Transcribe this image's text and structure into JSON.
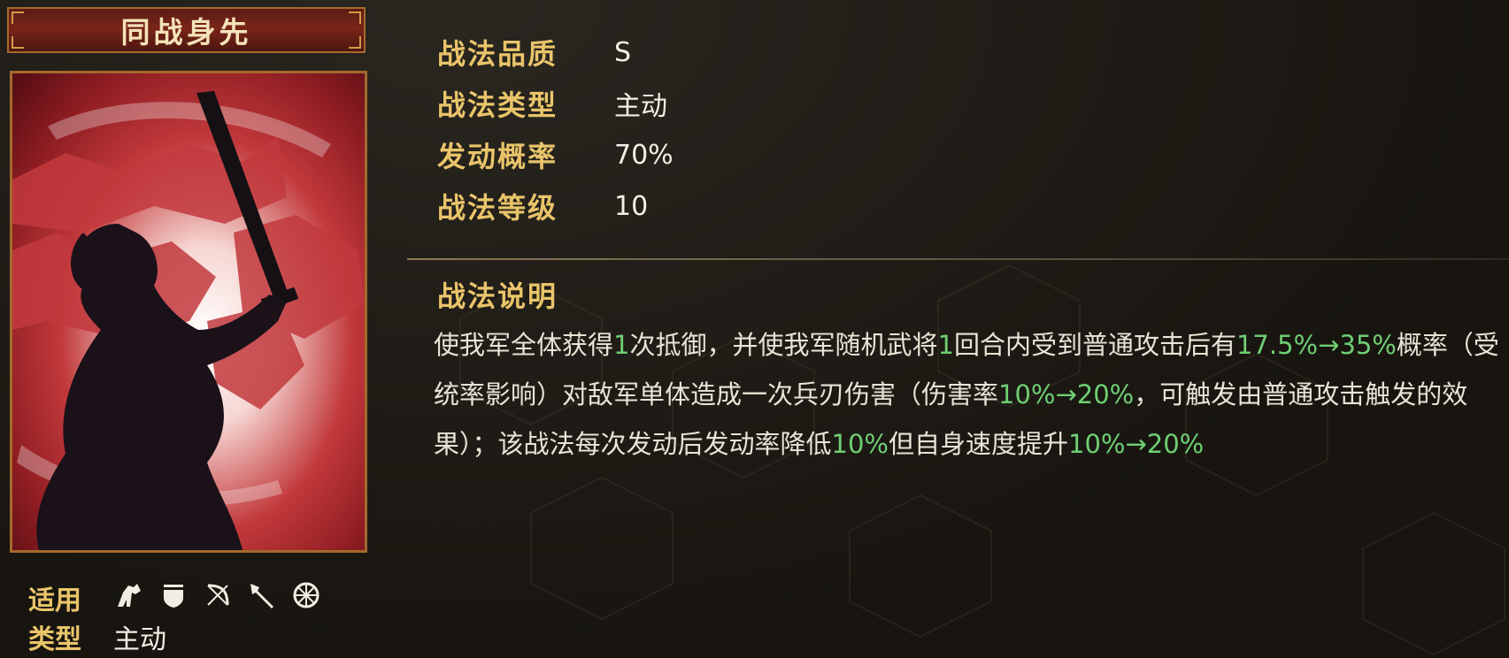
{
  "skill": {
    "name": "同战身先"
  },
  "stats": [
    {
      "label": "战法品质",
      "value": "S"
    },
    {
      "label": "战法类型",
      "value": "主动"
    },
    {
      "label": "发动概率",
      "value": "70%"
    },
    {
      "label": "战法等级",
      "value": "10"
    }
  ],
  "description": {
    "title": "战法说明",
    "segments": [
      {
        "text": "使我军全体获得",
        "highlight": false
      },
      {
        "text": "1",
        "highlight": true
      },
      {
        "text": "次抵御，并使我军随机武将",
        "highlight": false
      },
      {
        "text": "1",
        "highlight": true
      },
      {
        "text": "回合内受到普通攻击后有",
        "highlight": false
      },
      {
        "text": "17.5%→35%",
        "highlight": true
      },
      {
        "text": "概率（受统率影响）对敌军单体造成一次兵刃伤害（伤害率",
        "highlight": false
      },
      {
        "text": "10%→20%",
        "highlight": true
      },
      {
        "text": "，可触发由普通攻击触发的效果）；该战法每次发动后发动率降低",
        "highlight": false
      },
      {
        "text": "10%",
        "highlight": true
      },
      {
        "text": "但自身速度提升",
        "highlight": false
      },
      {
        "text": "10%→20%",
        "highlight": true
      }
    ]
  },
  "applicable": {
    "label": "适用",
    "icons": [
      "cavalry-icon",
      "shield-icon",
      "bow-icon",
      "spear-icon",
      "siege-icon"
    ]
  },
  "type": {
    "label": "类型",
    "value": "主动"
  },
  "colors": {
    "label_gold": "#e9c46a",
    "highlight_green": "#6fce73",
    "text_light": "#e8e4d6"
  }
}
